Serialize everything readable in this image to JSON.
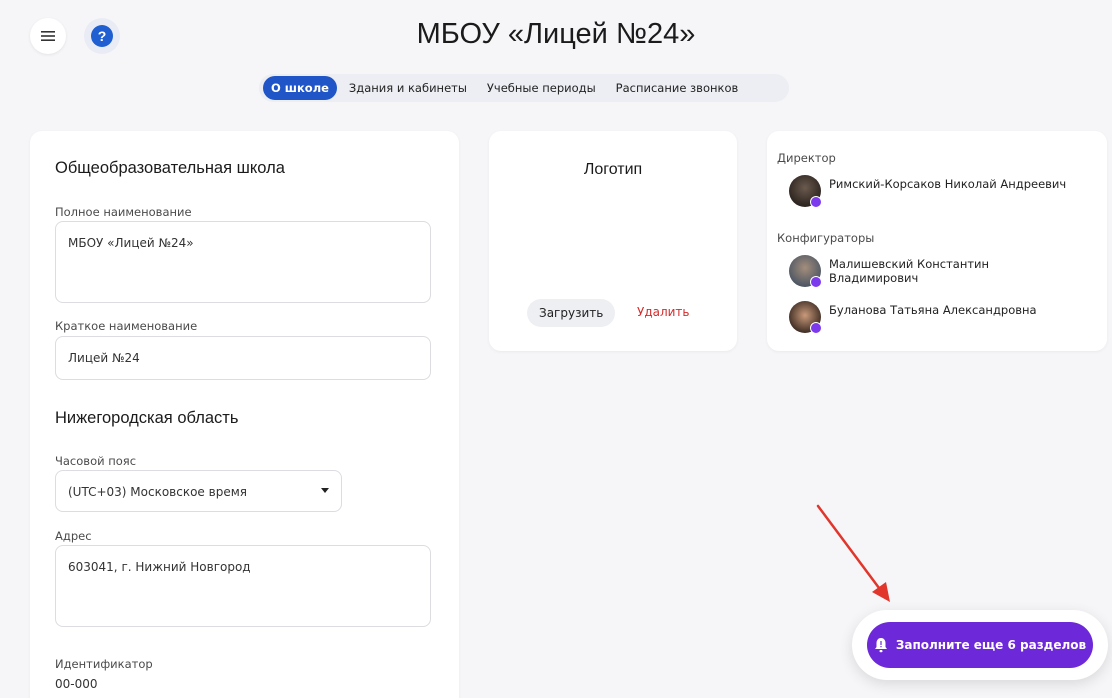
{
  "header": {
    "title": "МБОУ «Лицей №24»",
    "menu_icon": "hamburger-icon",
    "help_glyph": "?"
  },
  "tabs": [
    {
      "label": "О школе",
      "active": true
    },
    {
      "label": "Здания и кабинеты",
      "active": false
    },
    {
      "label": "Учебные периоды",
      "active": false
    },
    {
      "label": "Расписание звонков",
      "active": false
    }
  ],
  "school": {
    "type_title": "Общеобразовательная школа",
    "full_name_label": "Полное наименование",
    "full_name_value": "МБОУ «Лицей №24»",
    "short_name_label": "Краткое наименование",
    "short_name_value": "Лицей №24",
    "region_title": "Нижегородская область",
    "timezone_label": "Часовой пояс",
    "timezone_value": "(UTC+03) Московское время",
    "address_label": "Адрес",
    "address_value": "603041, г. Нижний Новгород",
    "id_label": "Идентификатор",
    "id_value": "00-000"
  },
  "logo": {
    "title": "Логотип",
    "upload_label": "Загрузить",
    "delete_label": "Удалить"
  },
  "people": {
    "director_label": "Директор",
    "director_name": "Римский-Корсаков Николай Андреевич",
    "configurators_label": "Конфигураторы",
    "configurator_1_line1": "Малишевский Константин",
    "configurator_1_line2": "Владимирович",
    "configurator_2": "Буланова Татьяна Александровна"
  },
  "cta": {
    "label": "Заполните еще 6 разделов"
  },
  "colors": {
    "accent_blue": "#1f55c6",
    "cta_purple": "#6d28d9",
    "delete_red": "#d42b2b",
    "arrow_red": "#e0362c"
  }
}
